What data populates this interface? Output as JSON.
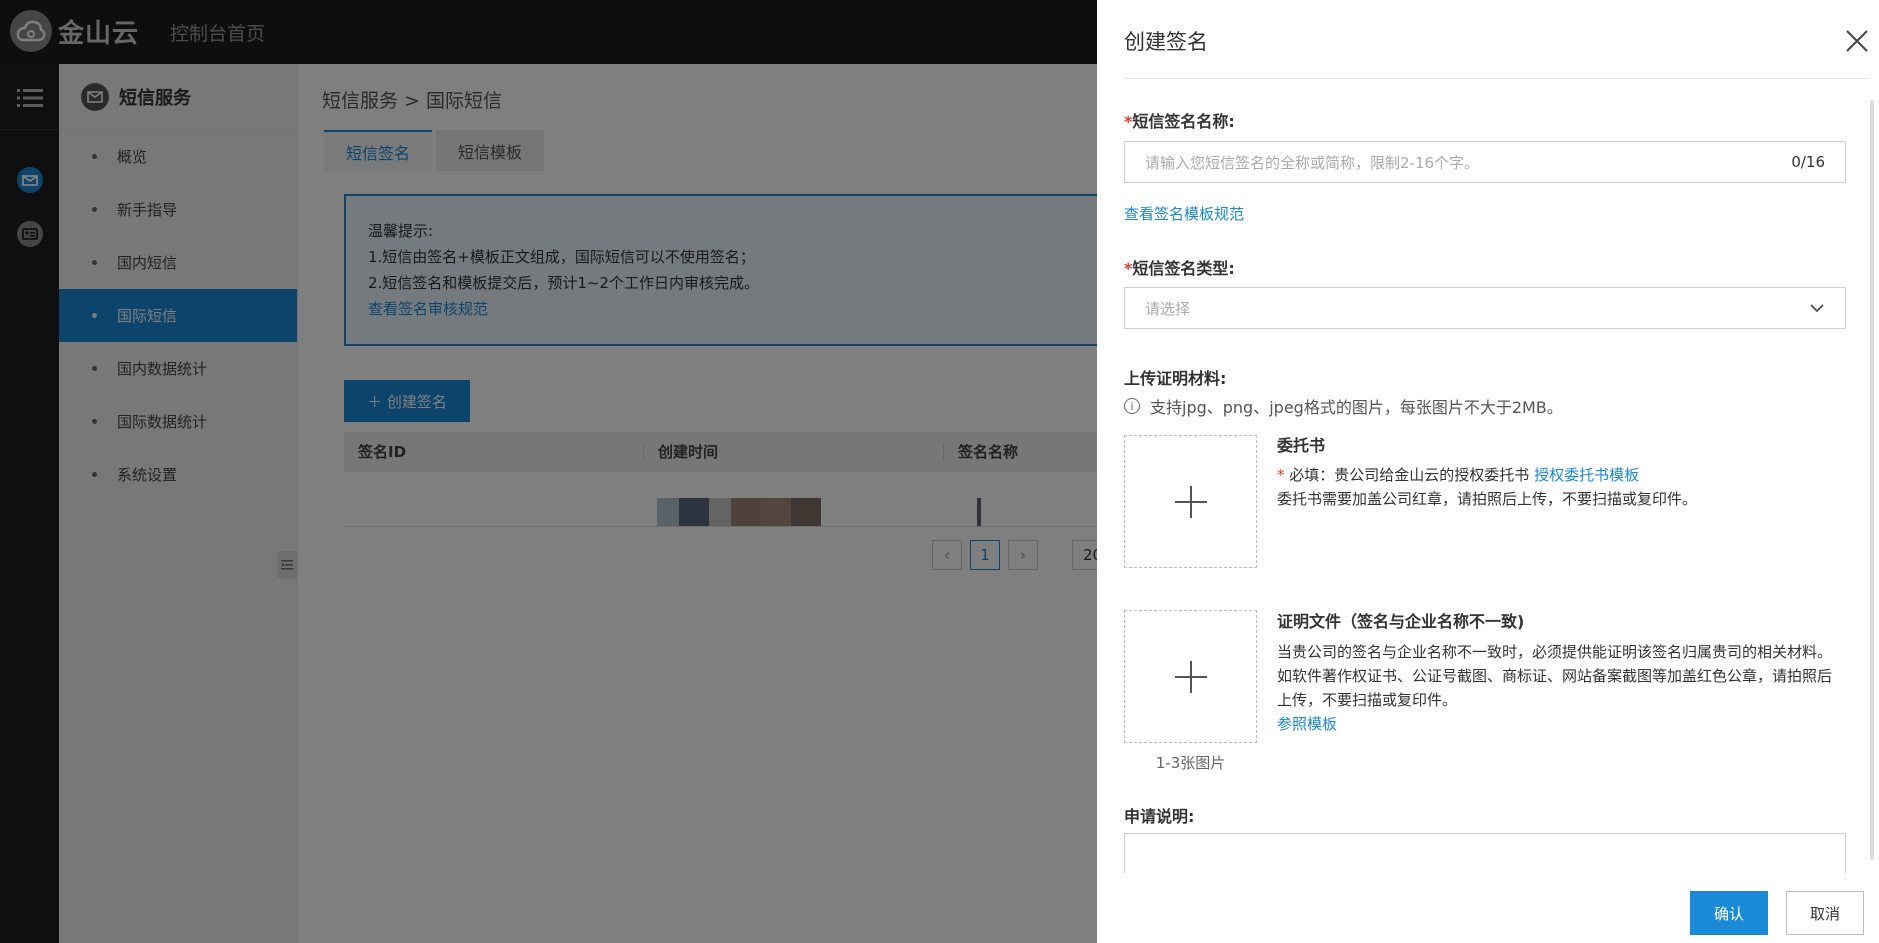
{
  "topbar": {
    "logo_text": "金山云",
    "console_home": "控制台首页"
  },
  "sidebar": {
    "title": "短信服务",
    "items": [
      {
        "label": "概览"
      },
      {
        "label": "新手指导"
      },
      {
        "label": "国内短信"
      },
      {
        "label": "国际短信",
        "active": true
      },
      {
        "label": "国内数据统计"
      },
      {
        "label": "国际数据统计"
      },
      {
        "label": "系统设置"
      }
    ]
  },
  "main": {
    "breadcrumb": "短信服务 > 国际短信",
    "tabs": [
      {
        "label": "短信签名",
        "active": true
      },
      {
        "label": "短信模板"
      }
    ],
    "notice": {
      "title": "温馨提示:",
      "line1": "1.短信由签名+模板正文组成，国际短信可以不使用签名；",
      "line2": "2.短信签名和模板提交后，预计1~2个工作日内审核完成。",
      "link": "查看签名审核规范"
    },
    "create_button": "＋ 创建签名",
    "table": {
      "columns": [
        "签名ID",
        "创建时间",
        "签名名称"
      ]
    },
    "pager": {
      "prev": "‹",
      "current": "1",
      "next": "›",
      "page_size": "20"
    }
  },
  "drawer": {
    "title": "创建签名",
    "name_label": "短信签名名称:",
    "name_placeholder": "请输入您短信签名的全称或简称，限制2-16个字。",
    "name_counter": "0/16",
    "template_link": "查看签名模板规范",
    "type_label": "短信签名类型:",
    "type_placeholder": "请选择",
    "upload_label": "上传证明材料:",
    "upload_hint": "支持jpg、png、jpeg格式的图片，每张图片不大于2MB。",
    "proxy": {
      "title": "委托书",
      "required_prefix": "必填：贵公司给金山云的授权委托书",
      "template_link": "授权委托书模板",
      "note": "委托书需要加盖公司红章，请拍照后上传，不要扫描或复印件。"
    },
    "proof": {
      "title": "证明文件（签名与企业名称不一致)",
      "text": "当贵公司的签名与企业名称不一致时，必须提供能证明该签名归属贵司的相关材料。如软件著作权证书、公证号截图、商标证、网站备案截图等加盖红色公章，请拍照后上传，不要扫描或复印件。",
      "link": "参照模板",
      "caption": "1-3张图片"
    },
    "remark_label": "申请说明:",
    "confirm_button": "确认",
    "cancel_button": "取消"
  },
  "colors": {
    "accent": "#1a89d8",
    "topbar": "#1c1c1c",
    "required": "#e53935"
  }
}
